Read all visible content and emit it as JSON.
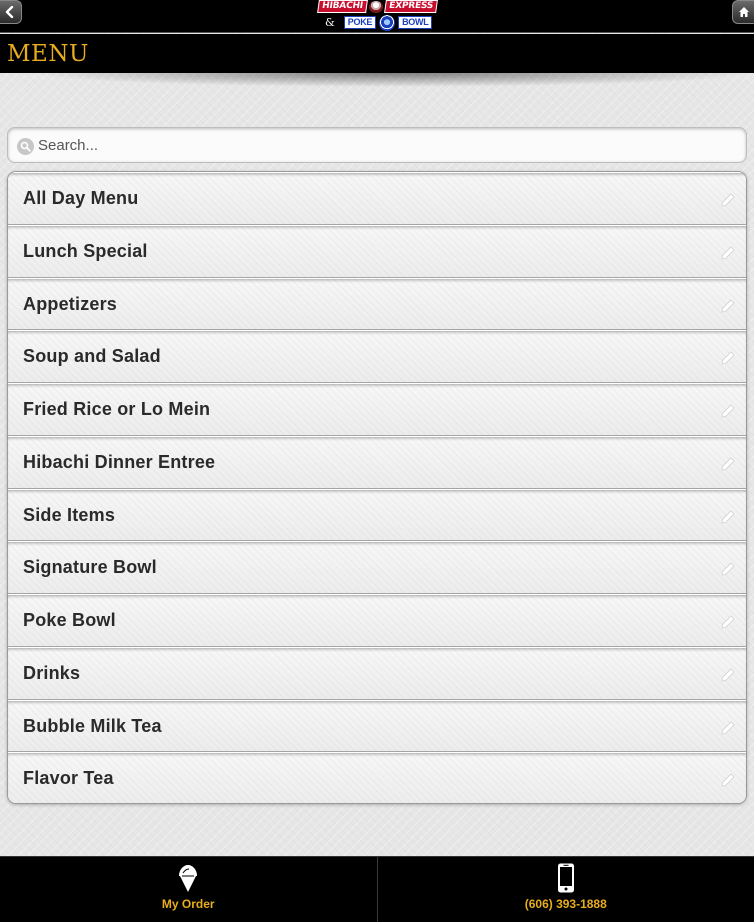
{
  "header": {
    "logo": {
      "line1_left": "HIBACHI",
      "line1_right": "EXPRESS",
      "amp": "&",
      "line2_left": "POKE",
      "line2_right": "BOWL"
    },
    "back_icon": "chevron-left-icon",
    "home_icon": "home-icon"
  },
  "title": "MENU",
  "search": {
    "placeholder": "Search...",
    "value": ""
  },
  "menu": {
    "items": [
      {
        "label": "All Day Menu"
      },
      {
        "label": "Lunch Special"
      },
      {
        "label": "Appetizers"
      },
      {
        "label": "Soup and Salad"
      },
      {
        "label": "Fried Rice or Lo Mein"
      },
      {
        "label": "Hibachi Dinner Entree"
      },
      {
        "label": "Side Items"
      },
      {
        "label": "Signature Bowl"
      },
      {
        "label": "Poke Bowl"
      },
      {
        "label": "Drinks"
      },
      {
        "label": "Bubble Milk Tea"
      },
      {
        "label": "Flavor Tea"
      }
    ]
  },
  "footer": {
    "order_label": "My Order",
    "phone_label": "(606) 393-1888"
  },
  "colors": {
    "accent": "#e8ad1c",
    "bar": "#000000",
    "background": "#e6e6e6"
  }
}
